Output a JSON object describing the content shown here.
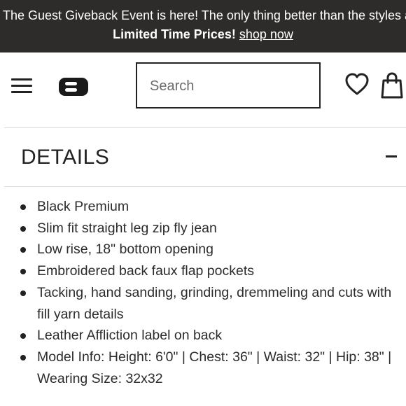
{
  "promo": {
    "line1": "The Guest Giveback Event is here! The only thing better than the styles are t",
    "line2_bold": "Limited Time Prices!",
    "link": "shop now"
  },
  "header": {
    "search_placeholder": "Search",
    "icons": [
      "menu-icon",
      "logo-icon",
      "heart-icon",
      "shopping-bag-icon"
    ]
  },
  "details": {
    "title": "DETAILS",
    "toggle": "−",
    "items": [
      "Black Premium",
      "Slim fit straight leg zip fly jean",
      "Low rise, 18\" bottom opening",
      "Embroidered back faux flap pockets",
      "Tacking, hand sanding, grinding, dremmeling and cuts with fill yarn details",
      "Leather Affliction label on back",
      "Model Info: Height: 6'0\" | Chest: 36\" | Waist: 32\" | Hip: 38\" | Wearing Size: 32x32"
    ]
  },
  "colors": {
    "promo_bg": "#2e2c2a",
    "text": "#222222",
    "divider": "#dddddd"
  }
}
